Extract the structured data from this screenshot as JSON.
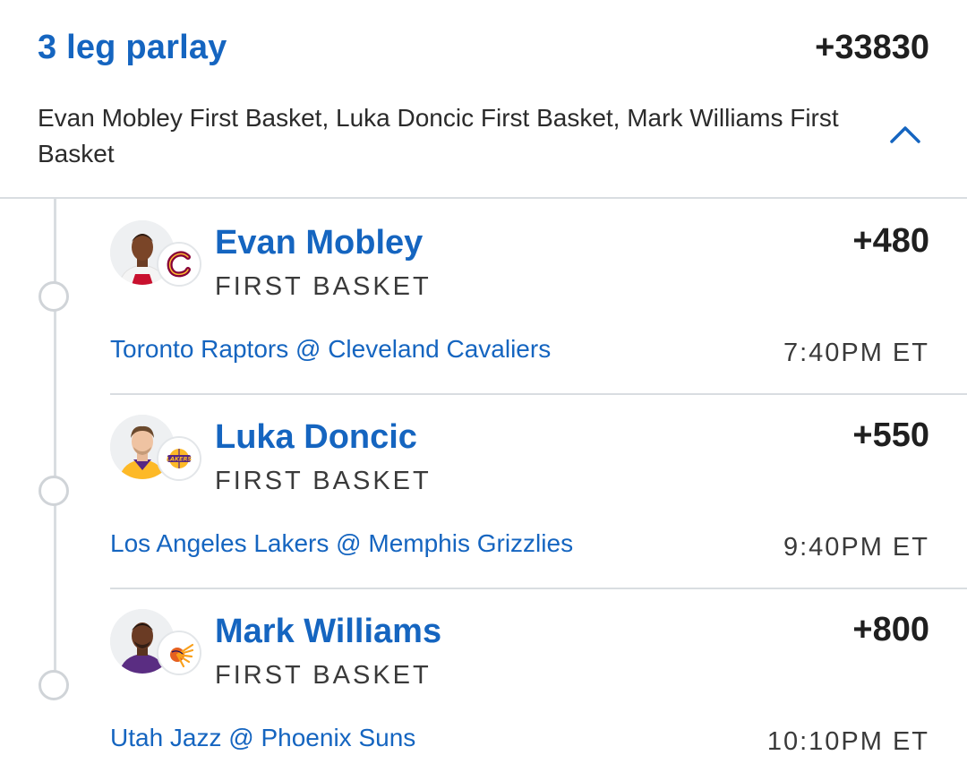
{
  "parlay": {
    "title": "3 leg parlay",
    "odds": "+33830",
    "description": "Evan Mobley First Basket, Luka Doncic First Basket, Mark Williams First Basket",
    "collapse_icon": "chevron-up-icon"
  },
  "legs": [
    {
      "player": "Evan Mobley",
      "market": "FIRST BASKET",
      "odds": "+480",
      "matchup": "Toronto Raptors @ Cleveland Cavaliers",
      "time": "7:40PM ET",
      "team_logo_icon": "cavaliers-logo-icon",
      "headshot_icon": "player-headshot-icon"
    },
    {
      "player": "Luka Doncic",
      "market": "FIRST BASKET",
      "odds": "+550",
      "matchup": "Los Angeles Lakers @ Memphis Grizzlies",
      "time": "9:40PM ET",
      "team_logo_icon": "lakers-logo-icon",
      "headshot_icon": "player-headshot-icon"
    },
    {
      "player": "Mark Williams",
      "market": "FIRST BASKET",
      "odds": "+800",
      "matchup": "Utah Jazz @ Phoenix Suns",
      "time": "10:10PM ET",
      "team_logo_icon": "suns-logo-icon",
      "headshot_icon": "player-headshot-icon"
    }
  ],
  "colors": {
    "accent": "#1565c0",
    "text": "#1f1f1f",
    "divider": "#d9dde1"
  }
}
